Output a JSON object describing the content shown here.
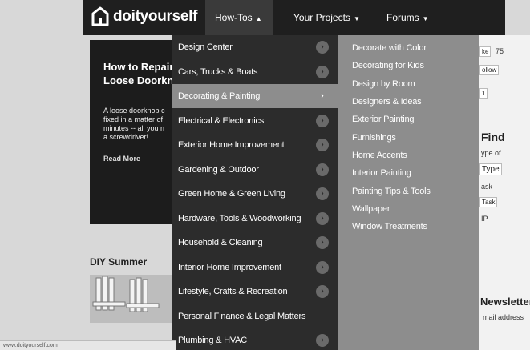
{
  "brand": {
    "name": "doityourself"
  },
  "nav": [
    {
      "label": "How-Tos",
      "active": true
    },
    {
      "label": "Your Projects",
      "active": false
    },
    {
      "label": "Forums",
      "active": false
    }
  ],
  "hero": {
    "title_lines": [
      "How to Repair",
      "Loose Doorkn"
    ],
    "text_lines": [
      "A loose doorknob c",
      "fixed in a matter of",
      "minutes -- all you n",
      "a screwdriver!"
    ],
    "read_more": "Read More"
  },
  "section_title": "DIY Summer",
  "menu": {
    "items": [
      "Design Center",
      "Cars, Trucks & Boats",
      "Decorating & Painting",
      "Electrical & Electronics",
      "Exterior Home Improvement",
      "Gardening & Outdoor",
      "Green Home & Green Living",
      "Hardware, Tools & Woodworking",
      "Household & Cleaning",
      "Interior Home Improvement",
      "Lifestyle, Crafts & Recreation",
      "Personal Finance & Legal Matters",
      "Plumbing & HVAC"
    ],
    "active_index": 2,
    "subitems": [
      "Decorate with Color",
      "Decorating for Kids",
      "Design by Room",
      "Designers & Ideas",
      "Exterior Painting",
      "Furnishings",
      "Home Accents",
      "Interior Painting",
      "Painting Tips & Tools",
      "Wallpaper",
      "Window Treatments"
    ]
  },
  "right_panel": {
    "like_label": "ke",
    "like_count": "75",
    "follow_label": "ollow",
    "plusone_count": "1",
    "find_title": "Find",
    "type_of": "ype of",
    "type_btn": "Type",
    "task_1": "ask",
    "task_2": "Task",
    "zip": "IP",
    "newsletter_title": "Newsletter",
    "email_label": "mail address"
  },
  "status_url": "www.doityourself.com"
}
